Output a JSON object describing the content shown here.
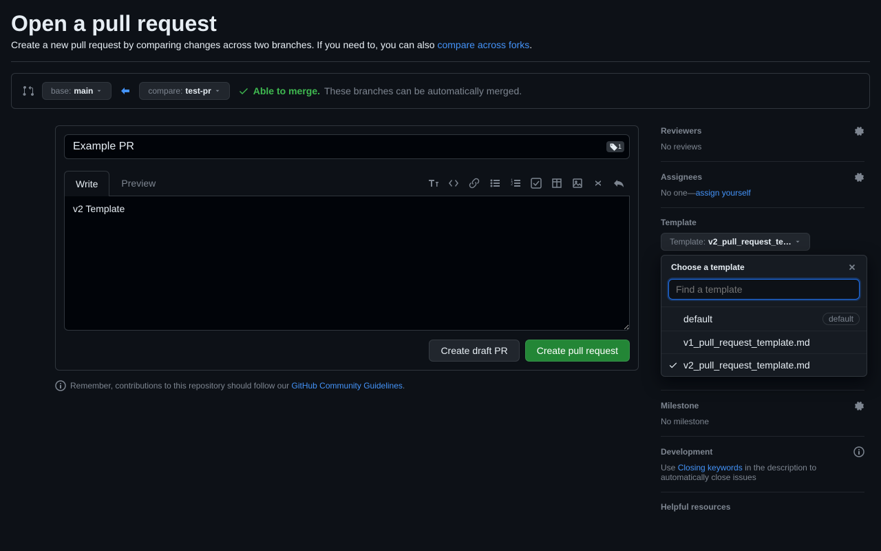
{
  "page_title": "Open a pull request",
  "subtitle_pre": "Create a new pull request by comparing changes across two branches. If you need to, you can also ",
  "compare_forks_link": "compare across forks",
  "subtitle_post": ".",
  "base_label": "base: ",
  "base_value": "main",
  "compare_label": "compare: ",
  "compare_value": "test-pr",
  "merge_able": "Able to merge.",
  "merge_msg": "These branches can be automatically merged.",
  "pr_title": "Example PR",
  "tabs": {
    "write": "Write",
    "preview": "Preview"
  },
  "pr_body": "v2 Template",
  "draft_button": "Create draft PR",
  "create_button": "Create pull request",
  "note_pre": "Remember, contributions to this repository should follow our ",
  "note_link": "GitHub Community Guidelines",
  "note_post": ".",
  "sidebar": {
    "reviewers": {
      "label": "Reviewers",
      "body": "No reviews"
    },
    "assignees": {
      "label": "Assignees",
      "body_pre": "No one—",
      "assign_self": "assign yourself"
    },
    "template": {
      "label": "Template",
      "button_label": "Template: ",
      "button_value": "v2_pull_request_te…"
    },
    "milestone": {
      "label": "Milestone",
      "body": "No milestone"
    },
    "development": {
      "label": "Development",
      "pre": "Use ",
      "link": "Closing keywords",
      "post": " in the description to automatically close issues"
    },
    "helpful": {
      "label": "Helpful resources"
    }
  },
  "popover": {
    "title": "Choose a template",
    "search_placeholder": "Find a template",
    "items": [
      {
        "label": "default",
        "badge": "default",
        "selected": false
      },
      {
        "label": "v1_pull_request_template.md",
        "selected": false
      },
      {
        "label": "v2_pull_request_template.md",
        "selected": true
      }
    ]
  }
}
